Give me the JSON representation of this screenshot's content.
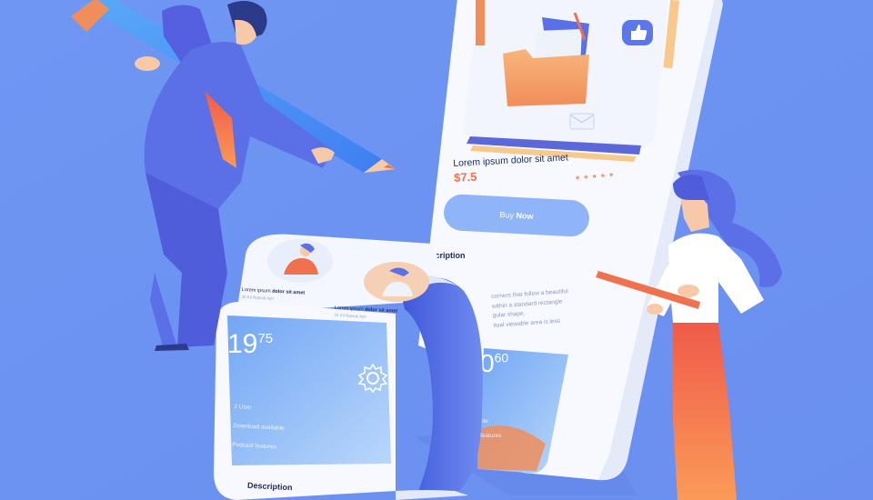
{
  "product": {
    "title": "Lorem ipsum dolor sit amet",
    "price": "$7.5",
    "rating_stars": "★★★★★",
    "rating_value_fraction": 0.8,
    "buy_button": {
      "prefix": "Buy ",
      "strong": "Now"
    },
    "description_heading": "Description",
    "description_text_lines": [
      "corners that follow a beautiful",
      "within a standard rectangle",
      "gular shape,",
      "itual viewable area is less"
    ]
  },
  "scroll_cards": [
    {
      "title_prefix": "Lorem ipsum ",
      "title_strong": "dolor sit amet",
      "subtitle": "35 Kil Rqmok Aytr"
    },
    {
      "title_prefix": "Lorem ipsum ",
      "title_strong": "dolor sit amet",
      "subtitle": "25 Kil Rqmok Aytr"
    }
  ],
  "plan_card": {
    "price_main": "19",
    "price_sup": "75",
    "features": [
      "2 User",
      "Download available",
      "Podcast features"
    ],
    "description_heading": "Description"
  },
  "plan_card_inner": {
    "price_main": "0",
    "price_sup": "60",
    "features_partial": [
      "ble",
      "features"
    ]
  },
  "colors": {
    "background": "#6c92f1",
    "accent_orange": "#f0714e",
    "button_blue": "#8fb4f7",
    "phone_white": "#f7f9ff",
    "character_blue": "#5b6fe6",
    "woman_pants": "#f26a52"
  },
  "icons": [
    "gear-icon",
    "like-icon",
    "mail-icon",
    "folder-icon",
    "pencil-icon",
    "ruler-icon"
  ]
}
